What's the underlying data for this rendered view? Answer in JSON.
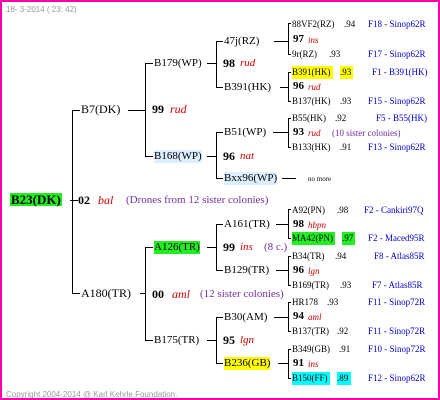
{
  "header": {
    "date": "18- 3-2014 ( 23: 42)"
  },
  "footer": {
    "copyright": "Copyright 2004-2014 @ Karl Kehrle Foundation."
  },
  "colors": {
    "frame": "#ff00aa",
    "highlight_green": "#22ee22",
    "highlight_yellow": "#ffff00",
    "highlight_cyan": "#00ffff",
    "link": "#0000cc",
    "italic_red": "#cc0000",
    "note_purple": "#7030a0"
  },
  "root": {
    "label": "B23(DK)",
    "num": "02",
    "strain": "bal",
    "note": "(Drones from 12 sister colonies)"
  },
  "gen1": [
    {
      "label": "B7(DK)"
    },
    {
      "label": "A180(TR)",
      "num": "00",
      "strain": "aml",
      "note": "(12 sister colonies)"
    }
  ],
  "gen2": [
    {
      "label": "B179(WP)",
      "num": "99",
      "strain": "rud"
    },
    {
      "label": "B168(WP)"
    },
    {
      "label": "A126(TR)",
      "num": "99",
      "strain": "ins",
      "note": "(8 c.)"
    },
    {
      "label": "B175(TR)",
      "num": "95",
      "strain": "lgn"
    }
  ],
  "gen3": [
    {
      "label": "47j(RZ)",
      "num": "98",
      "strain": "rud"
    },
    {
      "label": "B391(HK)"
    },
    {
      "label": "B51(WP)",
      "num": "96",
      "strain": "nat"
    },
    {
      "label": "Bxx96(WP)",
      "note": "no more"
    },
    {
      "label": "A161(TR)",
      "num": "98",
      "strain": "hbpn"
    },
    {
      "label": "B129(TR)"
    },
    {
      "label": "B30(AM)",
      "num": "94",
      "strain": "aml"
    },
    {
      "label": "B236(GB)",
      "num": "91",
      "strain": "ins"
    }
  ],
  "gen4": [
    {
      "name": "88VF2(RZ)",
      "year": ".94",
      "link": "F18 - Sinop62R"
    },
    {
      "name": "97",
      "strain": "ins"
    },
    {
      "name": "9r(RZ)",
      "year": ".93",
      "link": "F17 - Sinop62R"
    },
    {
      "name": "B391(HK)",
      "year": ".93",
      "link": "F1 - B391(HK)"
    },
    {
      "name": "96",
      "strain": "rud"
    },
    {
      "name": "B137(HK)",
      "year": ".93",
      "link": "F15 - Sinop62R"
    },
    {
      "name": "B55(HK)",
      "year": ".92",
      "link": "F5 - B55(HK)"
    },
    {
      "name": "93",
      "strain": "rud",
      "note": "(10 sister colonies)"
    },
    {
      "name": "B133(HK)",
      "year": ".91",
      "link": "F13 - Sinop62R"
    },
    {
      "name": "A92(PN)",
      "year": ".98",
      "link": "F2 - Cankiri97Q"
    },
    {
      "name": "98",
      "strain": "hbpn"
    },
    {
      "name": "MA42(PN)",
      "year": ".97",
      "link": "F2 - Maced95R"
    },
    {
      "name": "B34(TR)",
      "year": ".94",
      "link": "F8 - Atlas85R"
    },
    {
      "name": "96",
      "strain": "lgn"
    },
    {
      "name": "B169(TR)",
      "year": ".93",
      "link": "F7 - Atlas85R"
    },
    {
      "name": "HR178",
      "year": ".93",
      "link": "F11 - Sinop72R"
    },
    {
      "name": "94",
      "strain": "aml"
    },
    {
      "name": "B137(TR)",
      "year": ".92",
      "link": "F11 - Sinop72R"
    },
    {
      "name": "B349(GB)",
      "year": ".91",
      "link": "F10 - Sinop72R"
    },
    {
      "name": "91",
      "strain": "ins"
    },
    {
      "name": "B150(FF)",
      "year": ".89",
      "link": "F12 - Sinop62R"
    }
  ]
}
